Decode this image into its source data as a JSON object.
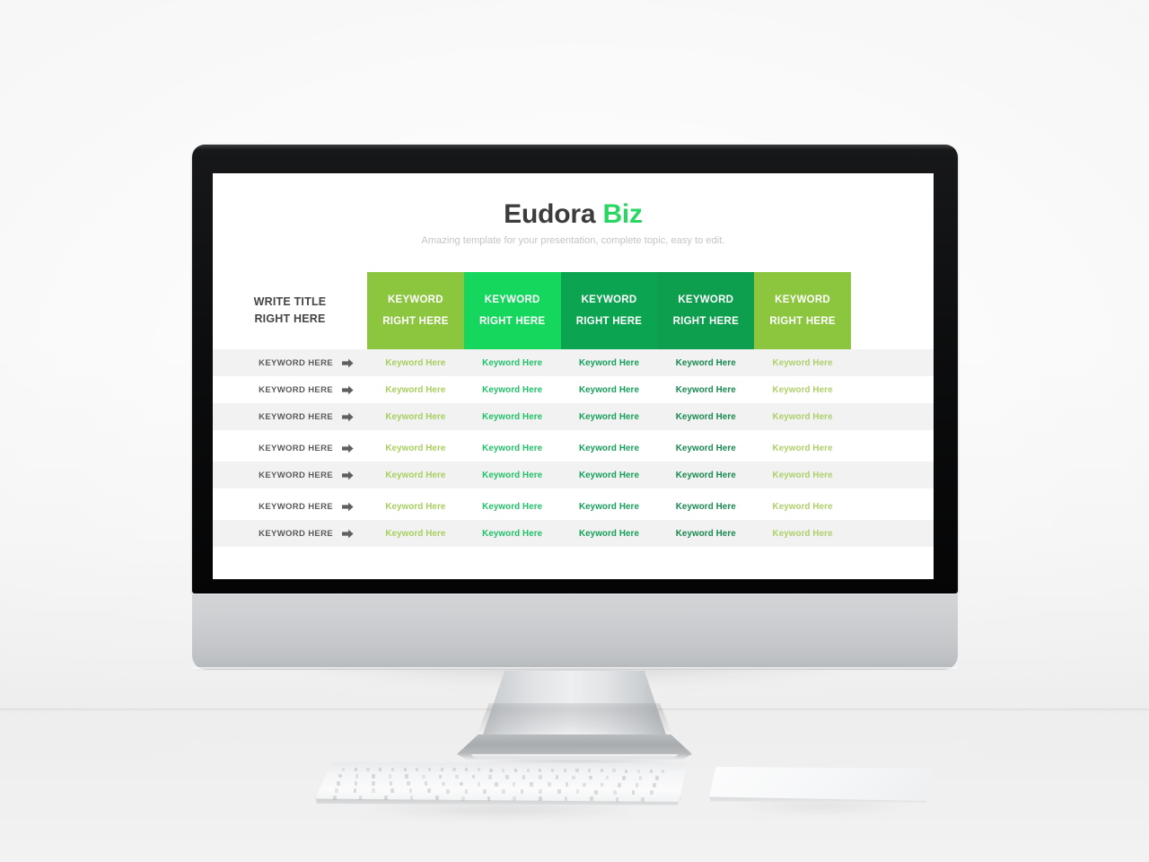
{
  "device": {
    "type": "desktop-monitor",
    "peripherals": [
      "keyboard",
      "trackpad"
    ]
  },
  "slide": {
    "title_main": "Eudora ",
    "title_accent": "Biz",
    "subtitle": "Amazing template for your presentation, complete topic, easy to edit.",
    "accent_color": "#2ad662",
    "title_color": "#3c3c3c",
    "subtitle_color": "#c4c4c4"
  },
  "table": {
    "corner_title_line1": "WRITE TITLE",
    "corner_title_line2": "RIGHT HERE",
    "columns": [
      {
        "line1": "KEYWORD",
        "line2": "RIGHT HERE",
        "header_bg": "#8cc63e",
        "body_color": "#a7cf5e"
      },
      {
        "line1": "KEYWORD",
        "line2": "RIGHT HERE",
        "header_bg": "#16d75e",
        "body_color": "#21c268"
      },
      {
        "line1": "KEYWORD",
        "line2": "RIGHT HERE",
        "header_bg": "#0ba551",
        "body_color": "#14a05a"
      },
      {
        "line1": "KEYWORD",
        "line2": "RIGHT HERE",
        "header_bg": "#0d9e4e",
        "body_color": "#17894f"
      },
      {
        "line1": "KEYWORD",
        "line2": "RIGHT HERE",
        "header_bg": "#8cc63e",
        "body_color": "#aed06a"
      }
    ],
    "row_label": "KEYWORD HERE",
    "row_arrow": "➡",
    "cell_value": "Keyword Here",
    "rows": [
      {
        "label": "KEYWORD HERE",
        "cells": [
          "Keyword Here",
          "Keyword Here",
          "Keyword Here",
          "Keyword Here",
          "Keyword Here"
        ]
      },
      {
        "label": "KEYWORD HERE",
        "cells": [
          "Keyword Here",
          "Keyword Here",
          "Keyword Here",
          "Keyword Here",
          "Keyword Here"
        ]
      },
      {
        "label": "KEYWORD HERE",
        "cells": [
          "Keyword Here",
          "Keyword Here",
          "Keyword Here",
          "Keyword Here",
          "Keyword Here"
        ]
      },
      {
        "label": "KEYWORD HERE",
        "cells": [
          "Keyword Here",
          "Keyword Here",
          "Keyword Here",
          "Keyword Here",
          "Keyword Here"
        ]
      },
      {
        "label": "KEYWORD HERE",
        "cells": [
          "Keyword Here",
          "Keyword Here",
          "Keyword Here",
          "Keyword Here",
          "Keyword Here"
        ]
      },
      {
        "label": "KEYWORD HERE",
        "cells": [
          "Keyword Here",
          "Keyword Here",
          "Keyword Here",
          "Keyword Here",
          "Keyword Here"
        ]
      },
      {
        "label": "KEYWORD HERE",
        "cells": [
          "Keyword Here",
          "Keyword Here",
          "Keyword Here",
          "Keyword Here",
          "Keyword Here"
        ]
      }
    ],
    "stripe_color": "#f2f2f2",
    "label_color": "#5a5a5a",
    "arrow_color": "#5f6062"
  }
}
